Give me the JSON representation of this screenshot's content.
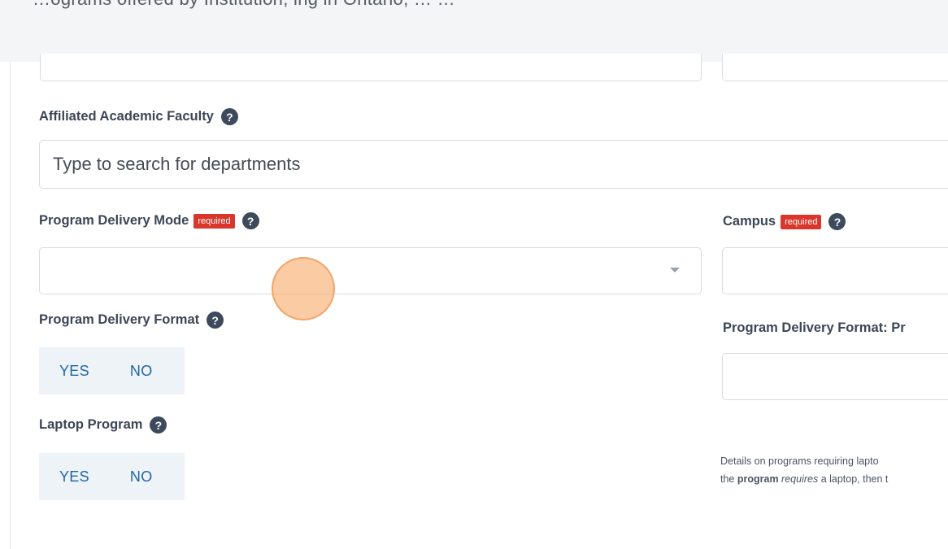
{
  "header": {
    "cutoff_text": "…ograms offered by Institution, ing in Ontario, …  …"
  },
  "fields": {
    "affiliated_faculty": {
      "label": "Affiliated Academic Faculty",
      "placeholder": "Type to search for departments"
    },
    "delivery_mode": {
      "label": "Program Delivery Mode",
      "required_badge": "required"
    },
    "campus": {
      "label": "Campus",
      "required_badge": "required"
    },
    "delivery_format": {
      "label": "Program Delivery Format",
      "yes": "YES",
      "no": "NO"
    },
    "delivery_format_pr": {
      "label": "Program Delivery Format: Pr"
    },
    "laptop_program": {
      "label": "Laptop Program",
      "yes": "YES",
      "no": "NO"
    },
    "laptop_details": {
      "line1": "Details on programs requiring lapto",
      "line2_a": "the ",
      "line2_b": "program",
      "line2_c": " ",
      "line2_d": "requires",
      "line2_e": " a laptop, then t"
    }
  },
  "icons": {
    "help": "question-circle-icon",
    "caret": "chevron-down-icon"
  },
  "colors": {
    "required": "#d9372b",
    "toggle_text": "#1f64a8",
    "toggle_bg": "#eef3f8",
    "cursor": "#f7a05a"
  }
}
